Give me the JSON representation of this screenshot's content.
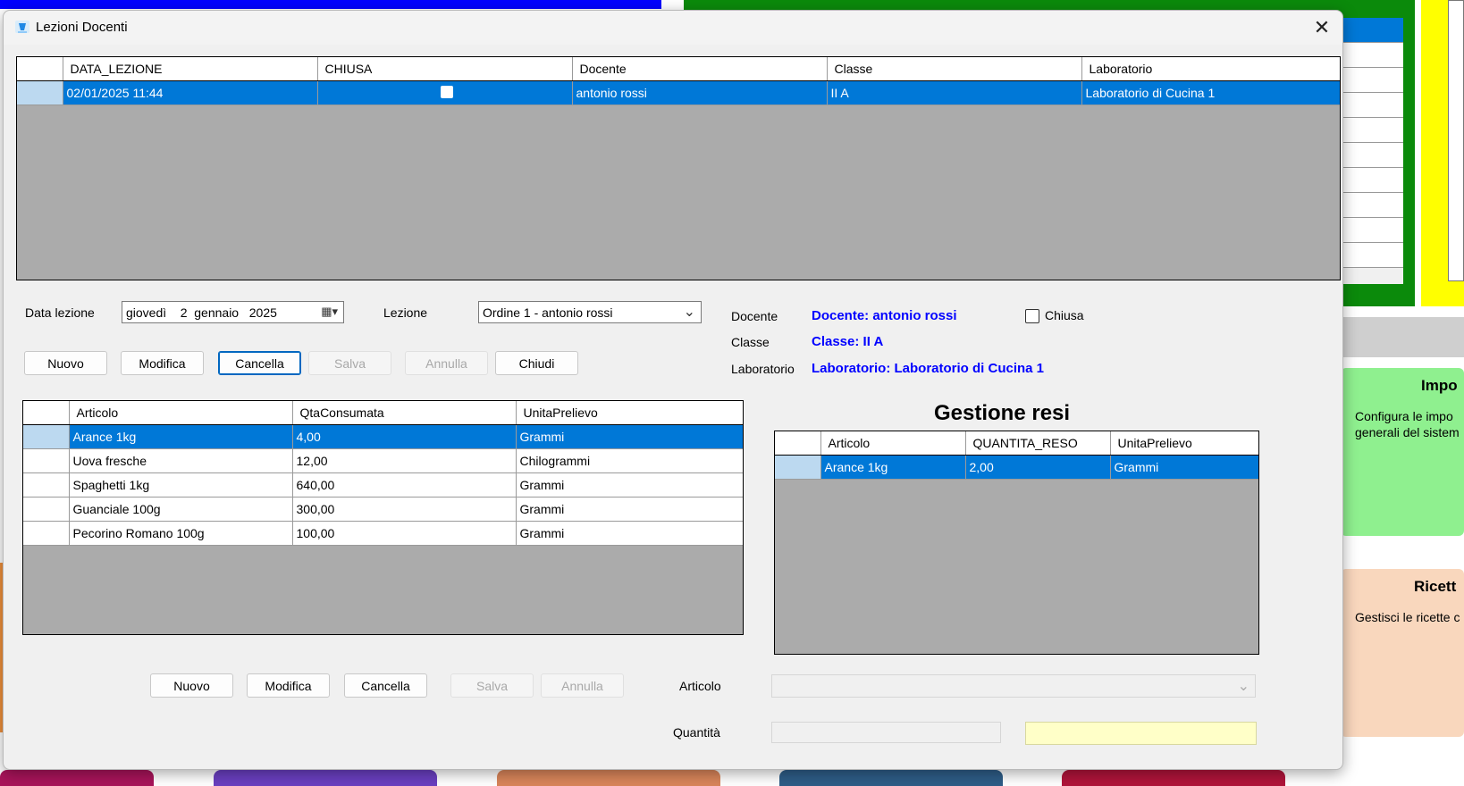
{
  "window": {
    "title": "Lezioni Docenti",
    "close_glyph": "✕"
  },
  "lessons_grid": {
    "columns": [
      "DATA_LEZIONE",
      "CHIUSA",
      "Docente",
      "Classe",
      "Laboratorio"
    ],
    "rows": [
      {
        "data_lezione": "02/01/2025 11:44",
        "chiusa": false,
        "docente": "antonio rossi",
        "classe": "II A",
        "laboratorio": "Laboratorio di Cucina 1",
        "selected": true
      }
    ]
  },
  "lesson_form": {
    "data_label": "Data lezione",
    "date_value": "giovedì    2  gennaio   2025",
    "calendar_glyph": "▦▾",
    "lezione_label": "Lezione",
    "lezione_value": "Ordine 1 - antonio rossi",
    "dropdown_glyph": "⌄",
    "docente_label": "Docente",
    "docente_value": "Docente: antonio rossi",
    "classe_label": "Classe",
    "classe_value": "Classe: II A",
    "laboratorio_label": "Laboratorio",
    "laboratorio_value": "Laboratorio: Laboratorio di Cucina 1",
    "chiusa_label": "Chiusa",
    "chiusa_checked": false
  },
  "toolbar_top": {
    "nuovo": "Nuovo",
    "modifica": "Modifica",
    "cancella": "Cancella",
    "salva": "Salva",
    "annulla": "Annulla",
    "chiudi": "Chiudi"
  },
  "articles_grid": {
    "columns": [
      "Articolo",
      "QtaConsumata",
      "UnitaPrelievo"
    ],
    "rows": [
      {
        "articolo": "Arance 1kg",
        "qta": "4,00",
        "unita": "Grammi",
        "selected": true
      },
      {
        "articolo": "Uova fresche",
        "qta": "12,00",
        "unita": "Chilogrammi",
        "selected": false
      },
      {
        "articolo": "Spaghetti 1kg",
        "qta": "640,00",
        "unita": "Grammi",
        "selected": false
      },
      {
        "articolo": "Guanciale 100g",
        "qta": "300,00",
        "unita": "Grammi",
        "selected": false
      },
      {
        "articolo": "Pecorino Romano 100g",
        "qta": "100,00",
        "unita": "Grammi",
        "selected": false
      }
    ]
  },
  "returns": {
    "title": "Gestione resi",
    "columns": [
      "Articolo",
      "QUANTITA_RESO",
      "UnitaPrelievo"
    ],
    "rows": [
      {
        "articolo": "Arance 1kg",
        "quantita": "2,00",
        "unita": "Grammi",
        "selected": true
      }
    ]
  },
  "toolbar_bottom": {
    "nuovo": "Nuovo",
    "modifica": "Modifica",
    "cancella": "Cancella",
    "salva": "Salva",
    "annulla": "Annulla"
  },
  "return_form": {
    "articolo_label": "Articolo",
    "articolo_value": "",
    "quantita_label": "Quantità",
    "quantita_value": ""
  },
  "background": {
    "card_green_title": "Impo",
    "card_green_desc": "Configura le impo\ngenerali del sistem",
    "card_peach_title": "Ricett",
    "card_peach_desc": "Gestisci le ricette c"
  },
  "colors": {
    "selection": "#0078d7",
    "grid_background": "#ababab",
    "info_text": "#0000ff",
    "dialog_background": "#f0f0f0"
  }
}
